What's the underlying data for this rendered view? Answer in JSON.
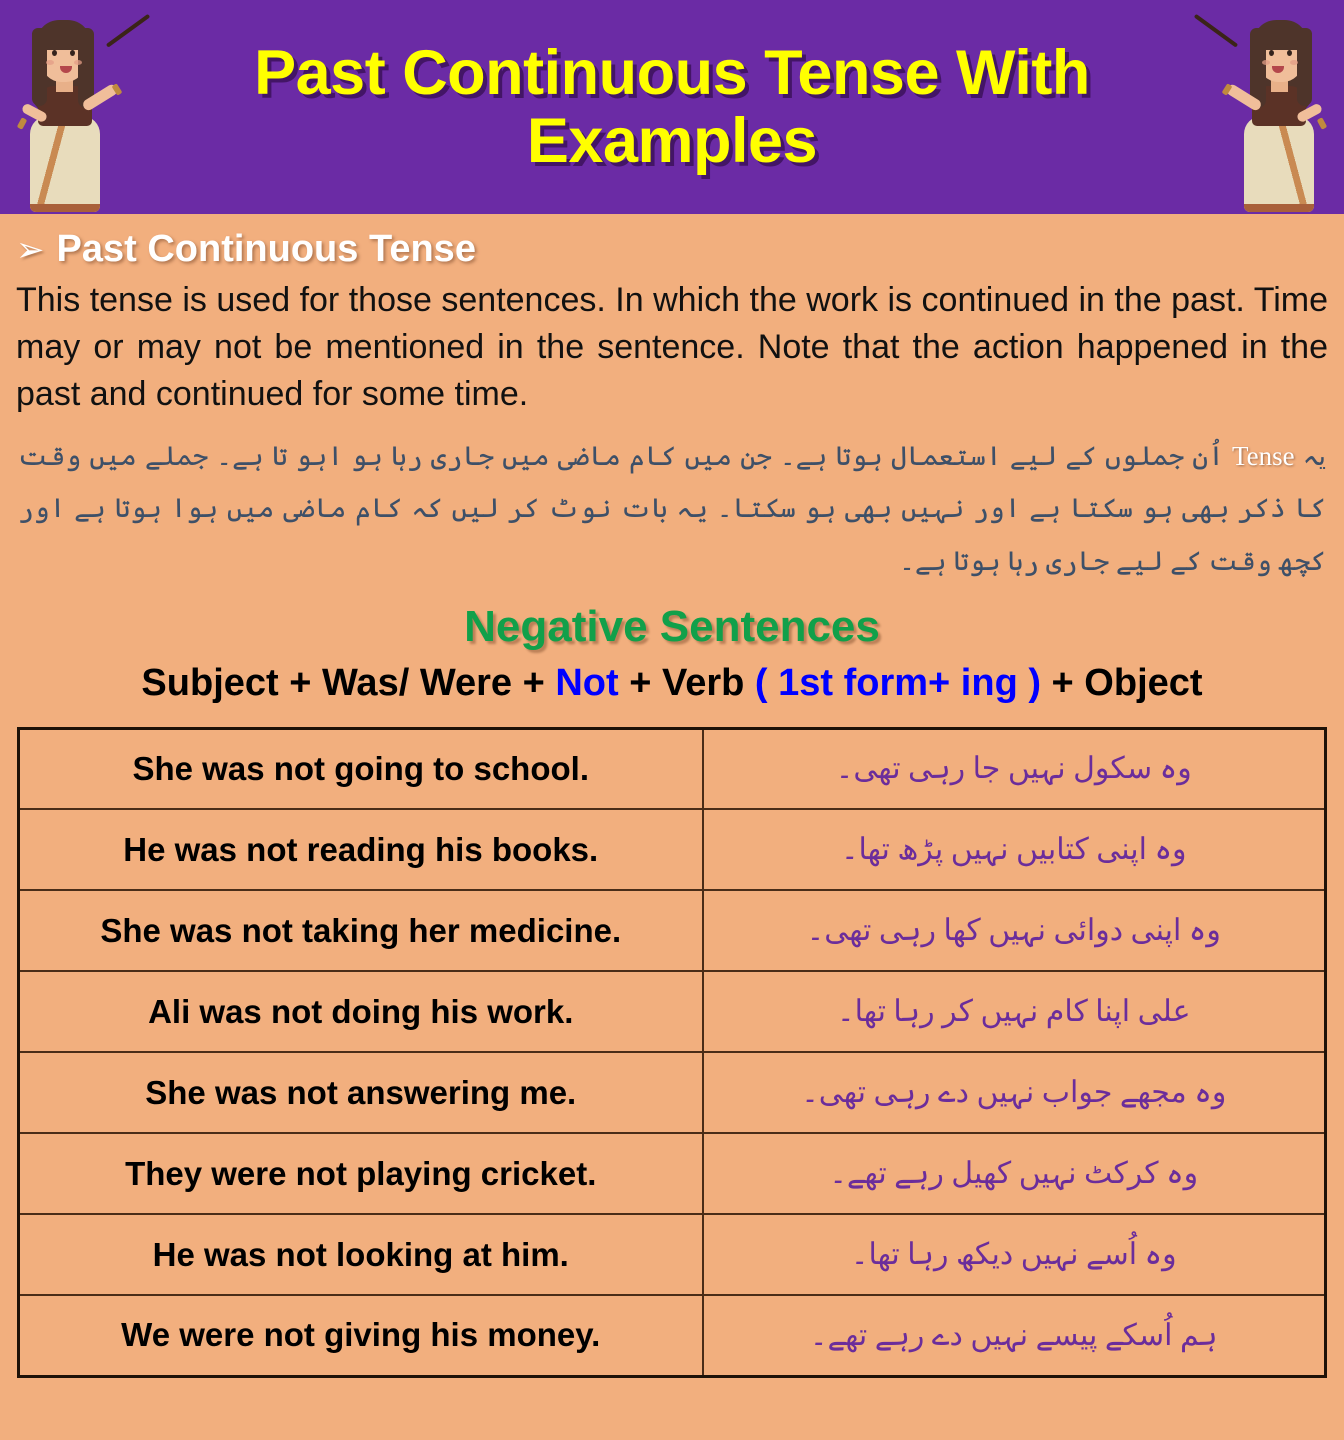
{
  "header": {
    "title": "Past Continuous Tense With Examples",
    "background_color": "#6B2BA5",
    "title_color": "#FFFF00",
    "left_illustration": "teacher-with-pointer",
    "right_illustration": "teacher-with-pointer"
  },
  "page": {
    "background_color": "#F2AF7E"
  },
  "section": {
    "bullet": "➢",
    "heading": "Past Continuous Tense",
    "intro": "This tense is used for those sentences. In which the work is continued in the past. Time may or may not be mentioned in the sentence. Note that the action happened in the past and continued for some time.",
    "urdu_intro_before": "یہ ",
    "urdu_intro_english_word": "Tense",
    "urdu_intro_after": " اُن جملوں کے لیے استعمال ہوتا ہے۔ جن میں کام ماضی میں جاری رہا ہو اہو تا ہے۔ جملے میں وقت کا ذکر بھی ہو سکتا ہے اور نہیں بھی ہو سکتا۔ یہ بات نوٹ کر لیں کہ کام ماضی میں ہوا ہوتا ہے اور کچھ وقت کے لیے جاری رہا ہوتا ہے۔"
  },
  "negative": {
    "heading": "Negative Sentences",
    "heading_color": "#11A04A",
    "formula_parts": [
      {
        "text": "Subject + Was/ Were + ",
        "color": "#000000"
      },
      {
        "text": "Not",
        "color": "#0000FF"
      },
      {
        "text": " + Verb ",
        "color": "#000000"
      },
      {
        "text": "( 1st form+ ing )",
        "color": "#0000FF"
      },
      {
        "text": " + Object",
        "color": "#000000"
      }
    ]
  },
  "table": {
    "english_color": "#000000",
    "urdu_color": "#6B2D9B",
    "rows": [
      {
        "english": "She was not going to school.",
        "urdu": "وہ سکول نہیں جا رہی تھی۔"
      },
      {
        "english": "He was not reading his books.",
        "urdu": "وہ اپنی کتابیں نہیں پڑھ تھا۔"
      },
      {
        "english": "She was not taking her medicine.",
        "urdu": "وہ اپنی دوائی نہیں کھا رہی تھی۔"
      },
      {
        "english": "Ali was not doing his work.",
        "urdu": "علی اپنا کام نہیں کر رہا تھا۔"
      },
      {
        "english": "She was not answering me.",
        "urdu": "وہ مجھے جواب نہیں دے رہی تھی۔"
      },
      {
        "english": "They were not playing cricket.",
        "urdu": "وہ کرکٹ نہیں کھیل رہے تھے۔"
      },
      {
        "english": "He was not looking at him.",
        "urdu": "وہ اُسے نہیں دیکھ رہا تھا۔"
      },
      {
        "english": "We were not giving his money.",
        "urdu": "ہم اُسکے پیسے نہیں دے رہے تھے۔"
      }
    ]
  }
}
